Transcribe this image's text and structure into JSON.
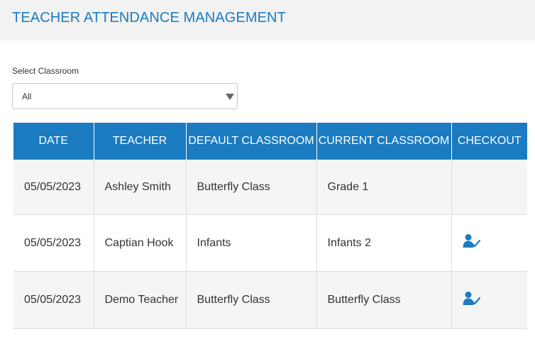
{
  "header": {
    "title": "TEACHER ATTENDANCE MANAGEMENT"
  },
  "filter": {
    "label": "Select Classroom",
    "selected": "All"
  },
  "table": {
    "columns": [
      "DATE",
      "TEACHER",
      "DEFAULT CLASSROOM",
      "CURRENT CLASSROOM",
      "CHECKOUT"
    ],
    "rows": [
      {
        "date": "05/05/2023",
        "teacher": "Ashley Smith",
        "default_classroom": "Butterfly Class",
        "current_classroom": "Grade 1",
        "checkout_icon": ""
      },
      {
        "date": "05/05/2023",
        "teacher": "Captian Hook",
        "default_classroom": "Infants",
        "current_classroom": "Infants 2",
        "checkout_icon": "user-check-icon"
      },
      {
        "date": "05/05/2023",
        "teacher": "Demo Teacher",
        "default_classroom": "Butterfly Class",
        "current_classroom": "Butterfly Class",
        "checkout_icon": "user-check-icon"
      }
    ]
  },
  "colors": {
    "accent": "#1a7bc1",
    "header_bg": "#f2f2f2",
    "row_alt": "#f5f5f5"
  }
}
